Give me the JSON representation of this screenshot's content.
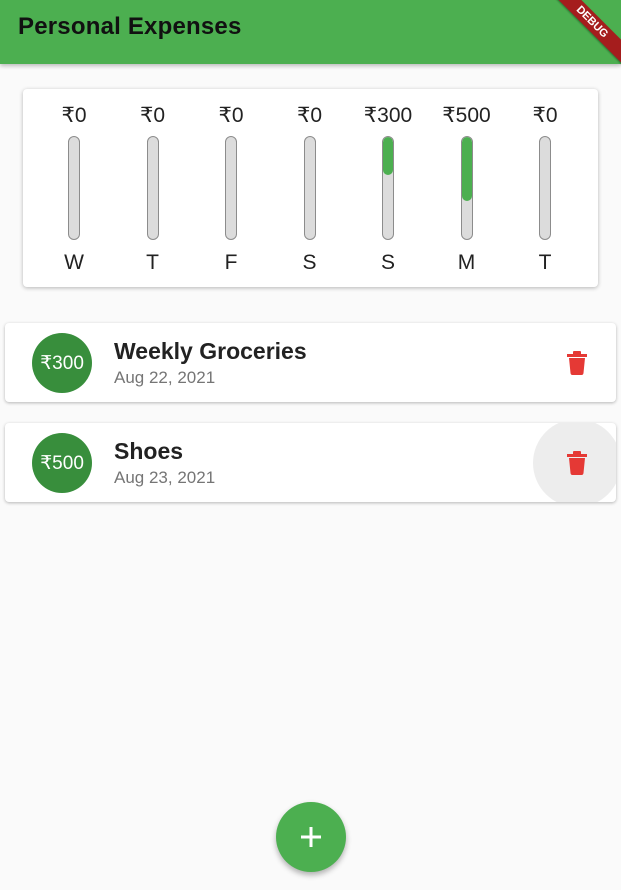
{
  "appbar": {
    "title": "Personal Expenses",
    "color": "#4caf50"
  },
  "debug_banner": {
    "label": "DEBUG"
  },
  "chart_data": {
    "type": "bar",
    "categories": [
      "W",
      "T",
      "F",
      "S",
      "S",
      "M",
      "T"
    ],
    "values": [
      0,
      0,
      0,
      0,
      300,
      500,
      0
    ],
    "value_labels": [
      "₹0",
      "₹0",
      "₹0",
      "₹0",
      "₹300",
      "₹500",
      "₹0"
    ],
    "fill_fraction": [
      0,
      0,
      0,
      0,
      0.375,
      0.625,
      0
    ],
    "title": "",
    "xlabel": "",
    "ylabel": "",
    "bar_color": "#4caf50",
    "track_color": "#dcdcdc"
  },
  "transactions": [
    {
      "amount": "₹300",
      "title": "Weekly Groceries",
      "date": "Aug 22, 2021",
      "delete_icon": "trash-icon"
    },
    {
      "amount": "₹500",
      "title": "Shoes",
      "date": "Aug 23, 2021",
      "delete_icon": "trash-icon"
    }
  ],
  "fab": {
    "icon": "plus-icon"
  },
  "colors": {
    "primary": "#4caf50",
    "avatar": "#388e3c",
    "delete": "#e53935"
  }
}
